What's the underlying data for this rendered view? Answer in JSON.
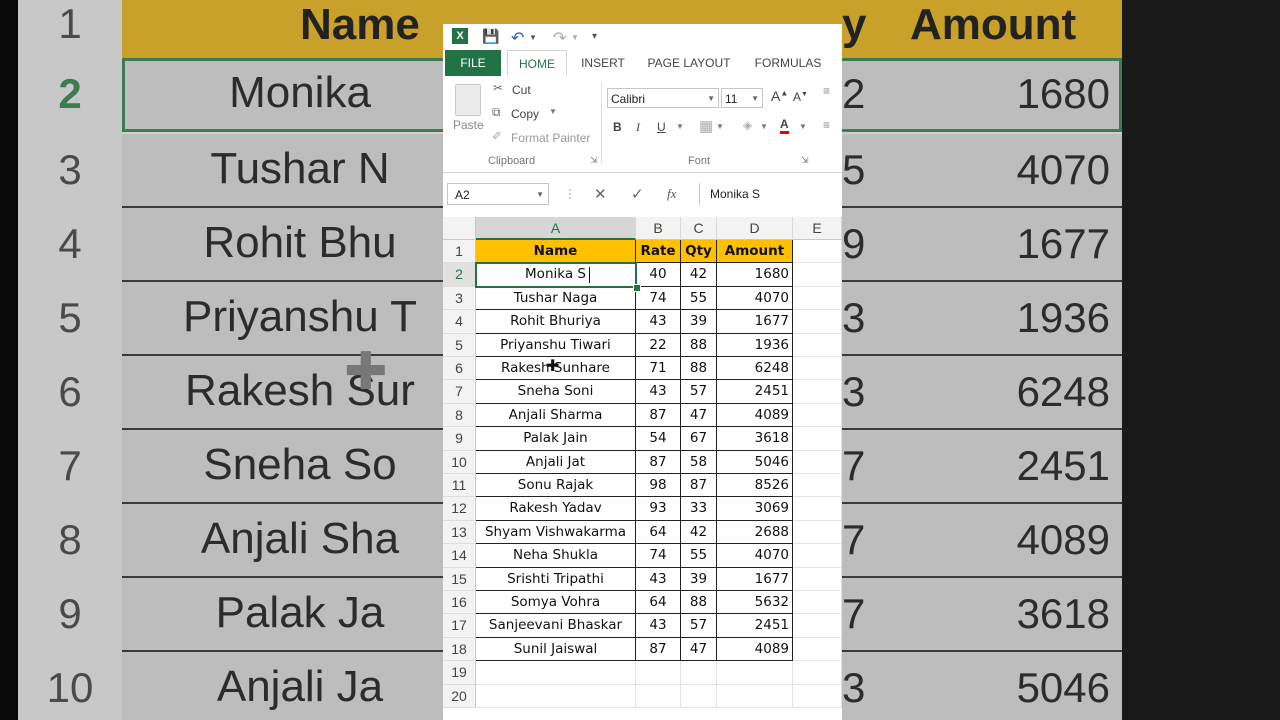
{
  "background": {
    "header_name": "Name",
    "header_qty": "y",
    "header_amount": "Amount",
    "row_numbers": [
      "1",
      "2",
      "3",
      "4",
      "5",
      "6",
      "7",
      "8",
      "9",
      "10"
    ],
    "names": [
      "Monika",
      "Tushar N",
      "Rohit Bhu",
      "Priyanshu T",
      "Rakesh Sur",
      "Sneha So",
      "Anjali Sha",
      "Palak Ja",
      "Anjali Ja"
    ],
    "qty_fragments": [
      "2",
      "5",
      "9",
      "3",
      "3",
      "7",
      "7",
      "7",
      "3"
    ],
    "amounts": [
      "1680",
      "4070",
      "1677",
      "1936",
      "6248",
      "2451",
      "4089",
      "3618",
      "5046"
    ]
  },
  "excel": {
    "tabs": {
      "file": "FILE",
      "home": "HOME",
      "insert": "INSERT",
      "page_layout": "PAGE LAYOUT",
      "formulas": "FORMULAS"
    },
    "clipboard": {
      "paste": "Paste",
      "cut": "Cut",
      "copy": "Copy",
      "format_painter": "Format Painter",
      "group_label": "Clipboard"
    },
    "font": {
      "name": "Calibri",
      "size": "11",
      "group_label": "Font",
      "bold": "B",
      "italic": "I",
      "underline": "U"
    },
    "name_box": "A2",
    "formula_value": "Monika S",
    "fx": "fx",
    "columns": [
      "A",
      "B",
      "C",
      "D",
      "E"
    ],
    "headers": [
      "Name",
      "Rate",
      "Qty",
      "Amount"
    ],
    "rows": [
      {
        "n": "2",
        "name": "Monika S",
        "rate": "40",
        "qty": "42",
        "amount": "1680"
      },
      {
        "n": "3",
        "name": "Tushar Naga",
        "rate": "74",
        "qty": "55",
        "amount": "4070"
      },
      {
        "n": "4",
        "name": "Rohit Bhuriya",
        "rate": "43",
        "qty": "39",
        "amount": "1677"
      },
      {
        "n": "5",
        "name": "Priyanshu Tiwari",
        "rate": "22",
        "qty": "88",
        "amount": "1936"
      },
      {
        "n": "6",
        "name": "Rakesh Sunhare",
        "rate": "71",
        "qty": "88",
        "amount": "6248"
      },
      {
        "n": "7",
        "name": "Sneha Soni",
        "rate": "43",
        "qty": "57",
        "amount": "2451"
      },
      {
        "n": "8",
        "name": "Anjali Sharma",
        "rate": "87",
        "qty": "47",
        "amount": "4089"
      },
      {
        "n": "9",
        "name": "Palak Jain",
        "rate": "54",
        "qty": "67",
        "amount": "3618"
      },
      {
        "n": "10",
        "name": "Anjali Jat",
        "rate": "87",
        "qty": "58",
        "amount": "5046"
      },
      {
        "n": "11",
        "name": "Sonu Rajak",
        "rate": "98",
        "qty": "87",
        "amount": "8526"
      },
      {
        "n": "12",
        "name": "Rakesh Yadav",
        "rate": "93",
        "qty": "33",
        "amount": "3069"
      },
      {
        "n": "13",
        "name": "Shyam Vishwakarma",
        "rate": "64",
        "qty": "42",
        "amount": "2688"
      },
      {
        "n": "14",
        "name": "Neha Shukla",
        "rate": "74",
        "qty": "55",
        "amount": "4070"
      },
      {
        "n": "15",
        "name": "Srishti Tripathi",
        "rate": "43",
        "qty": "39",
        "amount": "1677"
      },
      {
        "n": "16",
        "name": "Somya Vohra",
        "rate": "64",
        "qty": "88",
        "amount": "5632"
      },
      {
        "n": "17",
        "name": "Sanjeevani Bhaskar",
        "rate": "43",
        "qty": "57",
        "amount": "2451"
      },
      {
        "n": "18",
        "name": "Sunil Jaiswal",
        "rate": "87",
        "qty": "47",
        "amount": "4089"
      }
    ],
    "empty_rows": [
      "19",
      "20"
    ],
    "header_row_number": "1",
    "colors": {
      "accent": "#217346",
      "header_fill": "#ffc000"
    }
  }
}
